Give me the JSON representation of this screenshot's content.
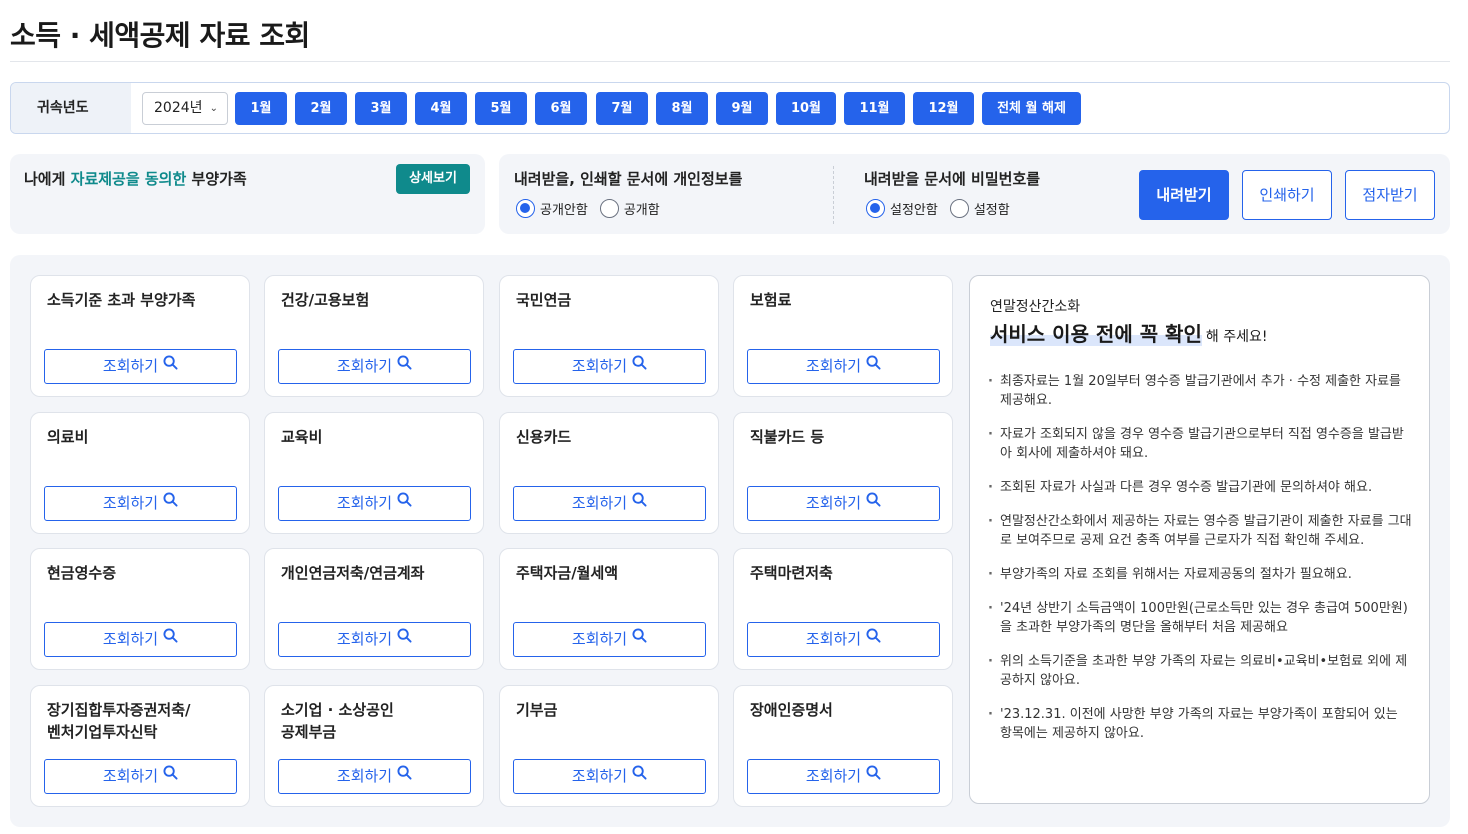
{
  "page": {
    "title": "소득 · 세액공제 자료 조회"
  },
  "filter": {
    "year_label": "귀속년도",
    "year_value": "2024년",
    "months": [
      "1월",
      "2월",
      "3월",
      "4월",
      "5월",
      "6월",
      "7월",
      "8월",
      "9월",
      "10월",
      "11월",
      "12월"
    ],
    "clear_all_label": "전체 월 해제"
  },
  "consent": {
    "prefix": "나에게",
    "accent": "자료제공을 동의한",
    "suffix": "부양가족",
    "detail_label": "상세보기"
  },
  "privacy": {
    "title": "내려받을, 인쇄할 문서에 개인정보를",
    "options": [
      "공개안함",
      "공개함"
    ],
    "selected": "공개안함"
  },
  "password": {
    "title": "내려받을 문서에 비밀번호를",
    "options": [
      "설정안함",
      "설정함"
    ],
    "selected": "설정안함"
  },
  "actions": {
    "download": "내려받기",
    "print": "인쇄하기",
    "braille": "점자받기"
  },
  "query_label": "조회하기",
  "cards": [
    "소득기준 초과 부양가족",
    "건강/고용보험",
    "국민연금",
    "보험료",
    "의료비",
    "교육비",
    "신용카드",
    "직불카드 등",
    "현금영수증",
    "개인연금저축/연금계좌",
    "주택자금/월세액",
    "주택마련저축",
    "장기집합투자증권저축/\n벤처기업투자신탁",
    "소기업 · 소상공인\n공제부금",
    "기부금",
    "장애인증명서"
  ],
  "notice": {
    "subtitle": "연말정산간소화",
    "headline": "서비스 이용 전에 꼭 확인",
    "headline_tail": "해 주세요!",
    "items": [
      "최종자료는 1월 20일부터 영수증 발급기관에서 추가 · 수정 제출한 자료를 제공해요.",
      "자료가 조회되지 않을 경우 영수증 발급기관으로부터 직접 영수증을 발급받아 회사에 제출하셔야 돼요.",
      "조회된 자료가 사실과 다른 경우 영수증 발급기관에 문의하셔야 해요.",
      "연말정산간소화에서 제공하는 자료는 영수증 발급기관이 제출한 자료를 그대로 보여주므로 공제 요건 충족 여부를 근로자가 직접 확인해 주세요.",
      "부양가족의 자료 조회를 위해서는 자료제공동의 절차가 필요해요.",
      "'24년 상반기 소득금액이 100만원(근로소득만 있는 경우 총급여 500만원)을 초과한 부양가족의 명단을 올해부터 처음 제공해요",
      "위의 소득기준을 초과한 부양 가족의 자료는 의료비•교육비•보험료 외에 제공하지 않아요.",
      "'23.12.31. 이전에 사망한 부양 가족의 자료는 부양가족이 포함되어 있는 항목에는 제공하지 않아요."
    ]
  },
  "colors": {
    "primary": "#2563eb",
    "teal": "#0f8a8c",
    "panel_bg": "#f3f5f9"
  }
}
